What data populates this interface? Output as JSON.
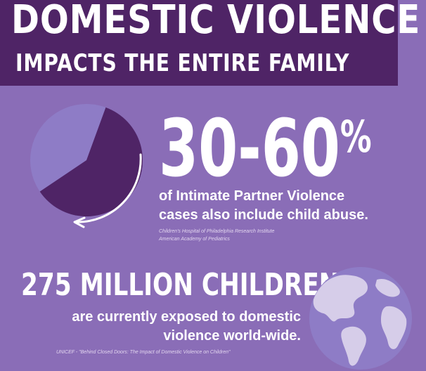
{
  "header": {
    "title": "DOMESTIC VIOLENCE",
    "subtitle": "IMPACTS THE ENTIRE FAMILY"
  },
  "stat1": {
    "value": "30-60",
    "unit": "%",
    "text_line1": "of Intimate Partner Violence",
    "text_line2": "cases also include child abuse.",
    "source_line1": "Children's Hospital of Philadelphia Research Institute",
    "source_line2": "American Academy of Pediatrics",
    "pie_highlight_fraction": 0.6,
    "pie_colors": {
      "highlight": "#4f2466",
      "rest": "#8e7cc6"
    }
  },
  "stat2": {
    "headline": "275 MILLION CHILDREN",
    "text_line1": "are currently exposed to domestic",
    "text_line2": "violence world-wide.",
    "source": "UNICEF - \"Behind Closed Doors: The Impact of Domestic Violence on Children\""
  },
  "icons": {
    "pie": "pie-chart-icon",
    "arrow": "curved-arrow-icon",
    "globe": "globe-icon"
  },
  "colors": {
    "background": "#8a6db7",
    "banner": "#4f2466",
    "globe_ocean": "#8e7cc6",
    "globe_land": "#d6cde9"
  }
}
